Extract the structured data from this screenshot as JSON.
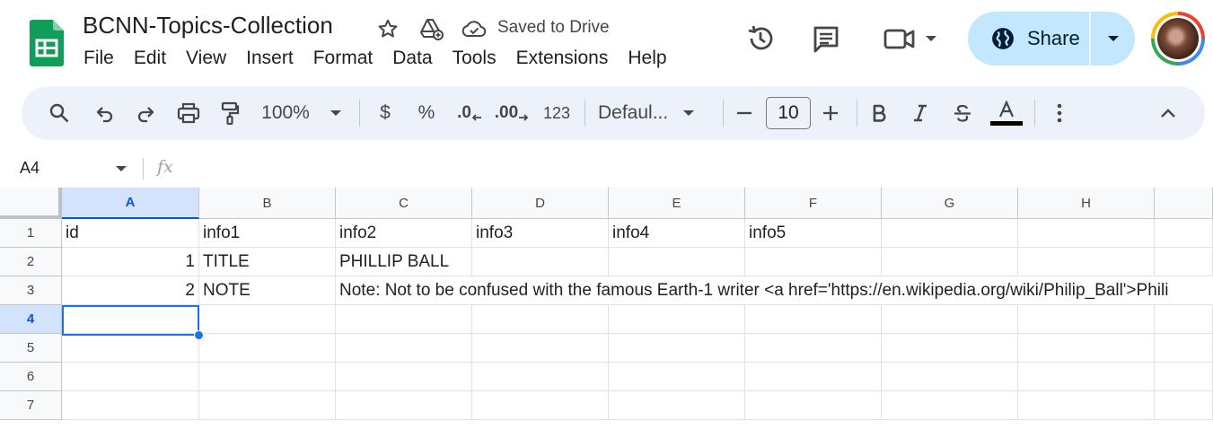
{
  "document": {
    "title": "BCNN-Topics-Collection",
    "save_status": "Saved to Drive"
  },
  "menu": [
    "File",
    "Edit",
    "View",
    "Insert",
    "Format",
    "Data",
    "Tools",
    "Extensions",
    "Help"
  ],
  "share": {
    "label": "Share"
  },
  "toolbar": {
    "zoom": "100%",
    "currency": "$",
    "percent": "%",
    "decrease_decimal": ".0",
    "increase_decimal": ".00",
    "more_formats": "123",
    "font_family": "Defaul...",
    "font_size": "10",
    "text_color_hex": "#000000"
  },
  "formula_bar": {
    "name_box": "A4",
    "fx_label": "fx",
    "formula": ""
  },
  "grid": {
    "columns": [
      "A",
      "B",
      "C",
      "D",
      "E",
      "F",
      "G",
      "H",
      ""
    ],
    "rows": [
      "1",
      "2",
      "3",
      "4",
      "5",
      "6",
      "7"
    ],
    "active_cell": "A4",
    "cells": {
      "A1": "id",
      "B1": "info1",
      "C1": "info2",
      "D1": "info3",
      "E1": "info4",
      "F1": "info5",
      "A2": "1",
      "B2": "TITLE",
      "C2": "PHILLIP BALL",
      "A3": "2",
      "B3": "NOTE",
      "C3": "Note: Not to be confused with the famous Earth-1 writer <a href='https://en.wikipedia.org/wiki/Philip_Ball'>Phili"
    }
  },
  "colors": {
    "accent": "#1a73e8",
    "share_bg": "#c2e7ff",
    "toolbar_bg": "#edf2fa",
    "sheets_green": "#0f9d58"
  }
}
